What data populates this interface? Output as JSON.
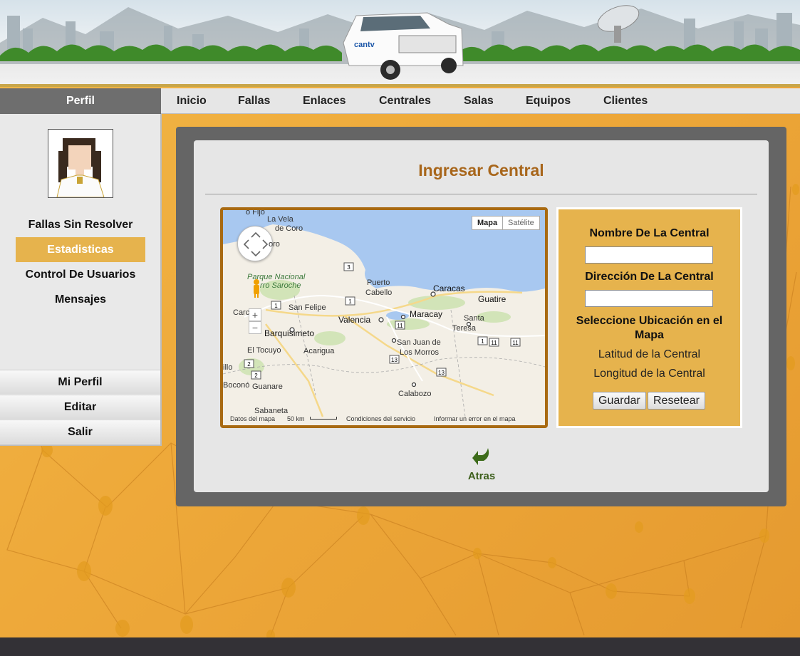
{
  "header": {
    "truck_logo": "cantv"
  },
  "nav": {
    "profile": "Perfil",
    "items": [
      "Inicio",
      "Fallas",
      "Enlaces",
      "Centrales",
      "Salas",
      "Equipos",
      "Clientes"
    ]
  },
  "sidebar": {
    "links": [
      "Fallas Sin Resolver",
      "Estadisticas",
      "Control De Usuarios",
      "Mensajes"
    ],
    "active": "Estadisticas",
    "buttons": [
      "Mi Perfil",
      "Editar",
      "Salir"
    ]
  },
  "main": {
    "title": "Ingresar Central",
    "back": "Atras"
  },
  "map": {
    "type_buttons": [
      "Mapa",
      "Satélite"
    ],
    "selected_type": "Mapa",
    "cities": {
      "caracas": "Caracas",
      "guatire": "Guatire",
      "maracay": "Maracay",
      "valencia": "Valencia",
      "barquisimeto": "Barquisimeto",
      "san_felipe": "San Felipe",
      "acarigua": "Acarigua",
      "el_tocuyo": "El Tocuyo",
      "guanare": "Guanare",
      "calabozo": "Calabozo",
      "san_juan": "San Juan de",
      "los_morros": "Los Morros",
      "santa": "Santa",
      "teresa": "Teresa",
      "puerto": "Puerto",
      "cabello": "Cabello",
      "la_vela": "La Vela",
      "de_coro": "de Coro",
      "coro": "oro",
      "punto_fijo": "o Fijo",
      "carora": "Carc",
      "trujillo": "illo",
      "bocono": "Boconó",
      "sabaneta": "Sabaneta",
      "park1": "Parque Nacional",
      "park2": "rro Saroche"
    },
    "roads": [
      "3",
      "1",
      "1",
      "11",
      "1",
      "11",
      "11",
      "13",
      "13",
      "2",
      "2"
    ],
    "footer": [
      "Datos del mapa",
      "50 km",
      "Condiciones del servicio",
      "Informar un error en el mapa"
    ]
  },
  "form": {
    "name_label": "Nombre De La Central",
    "name_value": "",
    "address_label": "Dirección De La Central",
    "address_value": "",
    "select_label": "Seleccione Ubicación en el Mapa",
    "latitude": "Latitud de la Central",
    "longitude": "Longitud de la Central",
    "save": "Guardar",
    "reset": "Resetear"
  }
}
